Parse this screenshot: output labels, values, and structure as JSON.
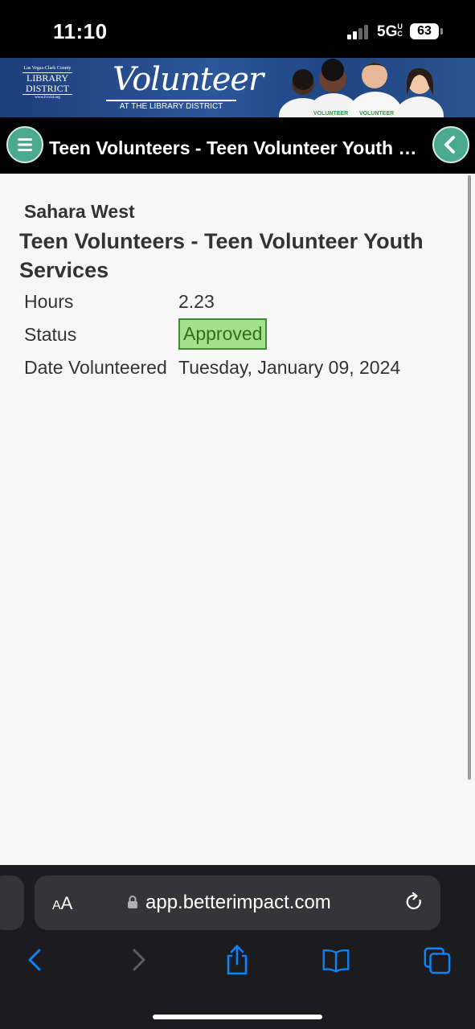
{
  "status_bar": {
    "time": "11:10",
    "network": "5GUC",
    "network_main": "5G",
    "network_sup": "UC",
    "battery": "63"
  },
  "banner": {
    "library_logo_top": "Las Vegas-Clark County",
    "library_logo_line1": "LIBRARY",
    "library_logo_line2": "DISTRICT",
    "library_logo_url": "www.lvccld.org",
    "volunteer_title": "Volunteer",
    "volunteer_subtitle": "AT THE LIBRARY DISTRICT",
    "shirt_text": "VOLUNTEER"
  },
  "title_bar": {
    "title": "Teen Volunteers - Teen Volunteer Youth Services",
    "menu_icon": "hamburger-menu-icon",
    "back_icon": "chevron-left-icon"
  },
  "details": {
    "location": "Sahara West",
    "opportunity": "Teen Volunteers - Teen Volunteer Youth Services",
    "rows": [
      {
        "label": "Hours",
        "value": "2.23"
      },
      {
        "label": "Status",
        "value": "Approved"
      },
      {
        "label": "Date Volunteered",
        "value": "Tuesday, January 09, 2024"
      }
    ]
  },
  "browser": {
    "text_size_label": "AA",
    "url": "app.betterimpact.com",
    "toolbar": [
      "back-icon",
      "forward-icon",
      "share-icon",
      "bookmarks-icon",
      "tabs-icon"
    ]
  },
  "colors": {
    "accent_button": "#4aa88e",
    "status_approved_bg": "#a2e28f",
    "status_approved_border": "#3e8a35",
    "link_blue": "#0a84ff"
  }
}
